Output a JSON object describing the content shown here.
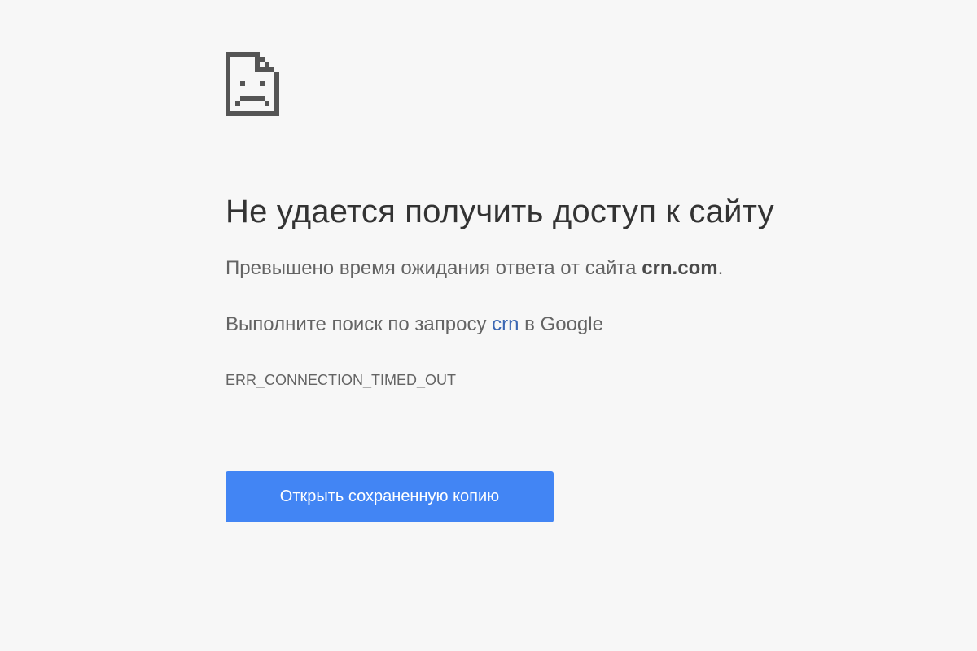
{
  "error_page": {
    "icon": "sad-page-icon",
    "title": "Не удается получить доступ к сайту",
    "summary_prefix": "Превышено время ожидания ответа от сайта ",
    "summary_host": "crn.com",
    "summary_suffix": ".",
    "suggestion_prefix": "Выполните поиск по запросу ",
    "suggestion_query": "crn",
    "suggestion_suffix": " в Google",
    "error_code": "ERR_CONNECTION_TIMED_OUT",
    "button_label": "Открыть сохраненную копию"
  },
  "colors": {
    "background": "#f7f7f7",
    "title": "#333333",
    "body_text": "#646464",
    "link": "#3b67b3",
    "button": "#4285f4",
    "icon": "#555555"
  }
}
